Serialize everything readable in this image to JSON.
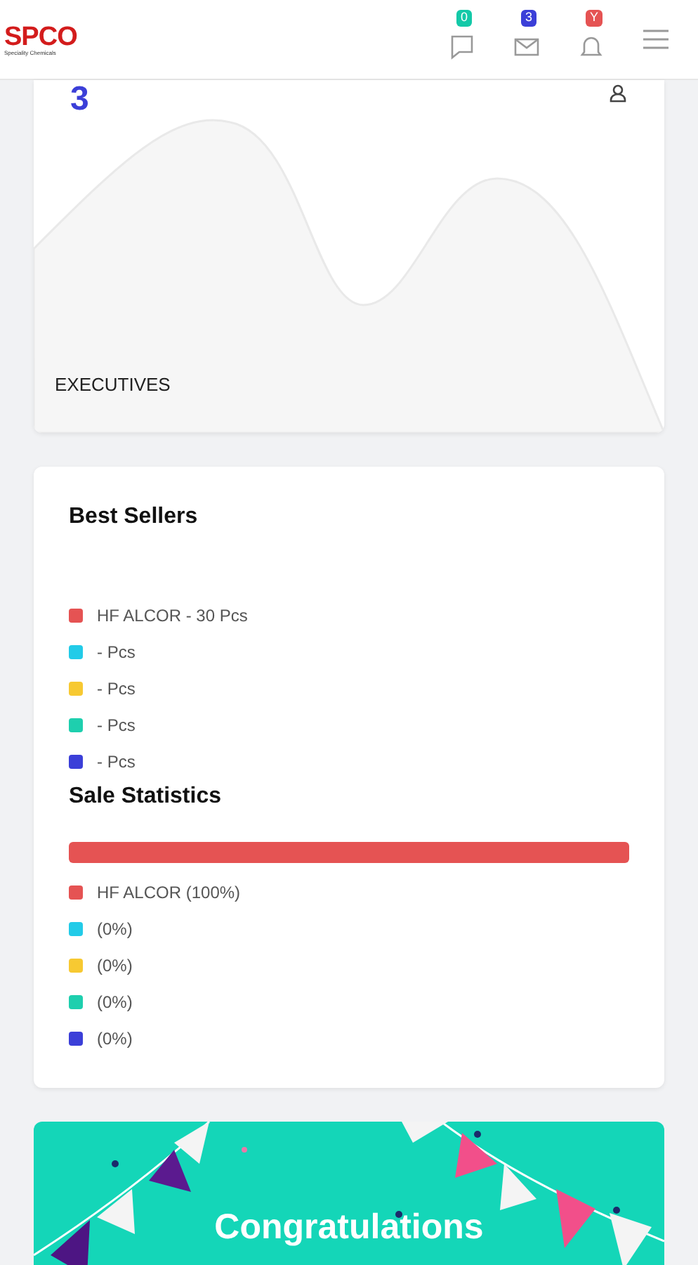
{
  "navbar": {
    "logo": "SPCO",
    "logo_subtitle": "Speciality Chemicals",
    "badges": [
      {
        "kind": "chat",
        "count": "0",
        "color": "#13c9a8"
      },
      {
        "kind": "mail",
        "count": "3",
        "color": "#3b3fd8"
      },
      {
        "kind": "bell",
        "count": "Y",
        "color": "#e55353"
      }
    ]
  },
  "executives_card": {
    "value": "3",
    "label": "EXECUTIVES"
  },
  "best_sellers": {
    "title": "Best Sellers",
    "items": [
      {
        "label": "HF ALCOR - 30 Pcs",
        "color": "#e55353"
      },
      {
        "label": "- Pcs",
        "color": "#22cbe8"
      },
      {
        "label": "- Pcs",
        "color": "#f7c932"
      },
      {
        "label": "- Pcs",
        "color": "#1ecfae"
      },
      {
        "label": "- Pcs",
        "color": "#3b3fd8"
      }
    ]
  },
  "sale_statistics": {
    "title": "Sale Statistics",
    "items": [
      {
        "label": "HF ALCOR (100%)",
        "color": "#e55353",
        "level": 1
      },
      {
        "label": "(0%)",
        "color": "#22cbe8",
        "level": 0
      },
      {
        "label": "(0%)",
        "color": "#f7c932",
        "level": 0
      },
      {
        "label": "(0%)",
        "color": "#1ecfae",
        "level": 0
      },
      {
        "label": "(0%)",
        "color": "#3b3fd8",
        "level": 0
      }
    ]
  },
  "congrats_card": {
    "title": "Congratulations"
  }
}
